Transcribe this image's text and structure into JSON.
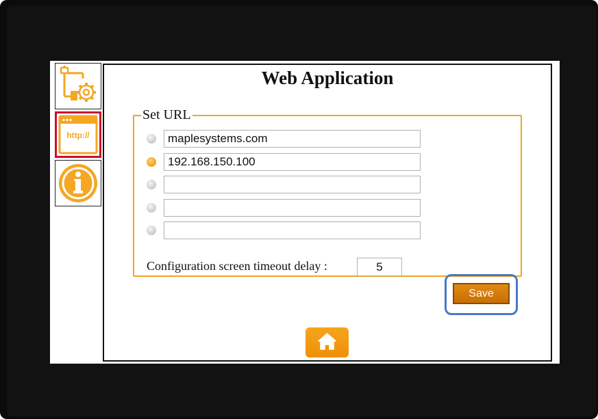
{
  "page": {
    "title": "Web Application"
  },
  "sidebar": {
    "items": [
      {
        "name": "network-settings",
        "icon": "network-gear-icon",
        "active": false
      },
      {
        "name": "web-application",
        "icon": "http-browser-icon",
        "icon_text": "http://",
        "active": true
      },
      {
        "name": "info",
        "icon": "info-icon",
        "active": false
      }
    ]
  },
  "url_group": {
    "legend": "Set URL",
    "urls": [
      {
        "value": "maplesystems.com",
        "selected": false
      },
      {
        "value": "192.168.150.100",
        "selected": true
      },
      {
        "value": "",
        "selected": false
      },
      {
        "value": "",
        "selected": false
      },
      {
        "value": "",
        "selected": false
      }
    ]
  },
  "timeout": {
    "label": "Configuration screen timeout delay :",
    "value": "5"
  },
  "buttons": {
    "save_label": "Save",
    "home_icon": "home-icon"
  },
  "colors": {
    "accent": "#f5a623",
    "save": "#d17a0a",
    "highlight": "#4a78c2",
    "active_border": "#c8102e"
  }
}
